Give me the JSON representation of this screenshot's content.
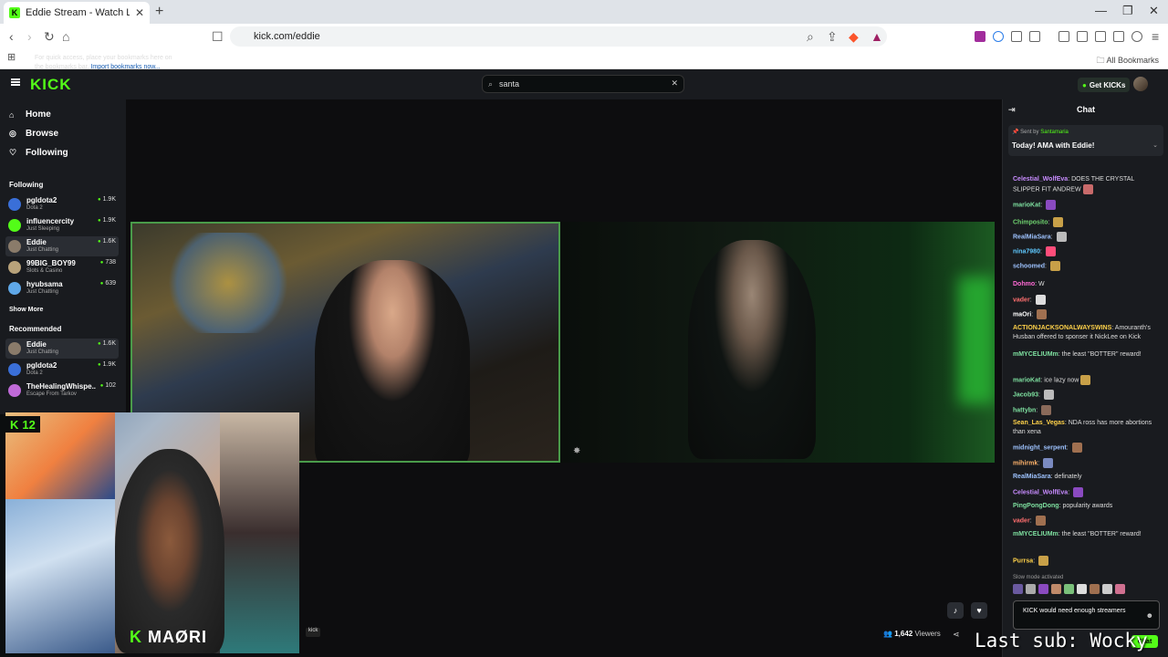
{
  "browser": {
    "tab_title": "Eddie Stream - Watch Live on",
    "url": "kick.com/eddie",
    "bookmarks_message": "For quick access, place your bookmarks here on the bookmarks bar.",
    "bookmarks_link": "Import bookmarks now...",
    "all_bookmarks": "All Bookmarks"
  },
  "header": {
    "logo": "KICK",
    "search_value": "santa",
    "get_kicks": "Get KICKs"
  },
  "sidebar": {
    "nav": [
      {
        "label": "Home"
      },
      {
        "label": "Browse"
      },
      {
        "label": "Following"
      }
    ],
    "following_title": "Following",
    "following": [
      {
        "name": "pgldota2",
        "category": "Dota 2",
        "viewers": "1.9K"
      },
      {
        "name": "influencercity",
        "category": "Just Sleeping",
        "viewers": "1.9K"
      },
      {
        "name": "Eddie",
        "category": "Just Chatting",
        "viewers": "1.6K"
      },
      {
        "name": "99BIG_BOY99",
        "category": "Slots & Casino",
        "viewers": "738"
      },
      {
        "name": "hyubsama",
        "category": "Just Chatting",
        "viewers": "639"
      }
    ],
    "show_more": "Show More",
    "recommended_title": "Recommended",
    "recommended": [
      {
        "name": "Eddie",
        "category": "Just Chatting",
        "viewers": "1.6K"
      },
      {
        "name": "pgldota2",
        "category": "Dota 2",
        "viewers": "1.9K"
      },
      {
        "name": "TheHealingWhispe...",
        "category": "Escape From Tarkov",
        "viewers": "102"
      }
    ]
  },
  "player": {
    "facecam_badge": "12",
    "facecam_brand_k": "K",
    "facecam_brand": "MAØRI",
    "kick_tag": "kick",
    "viewers_count": "1,642",
    "viewers_label": "Viewers",
    "last_sub": "Last sub: Wocky"
  },
  "chat": {
    "title": "Chat",
    "pinned_sent_by": "Sent by",
    "pinned_user": "Santamaria",
    "pinned_text": "Today! AMA with Eddie!",
    "messages": [
      {
        "user": "Celestial_WolfEva",
        "color": "#c88cff",
        "text": "DOES THE CRYSTAL SLIPPER FIT ANDREW"
      },
      {
        "user": "marioKat",
        "color": "#7ee0a0",
        "text": ""
      },
      {
        "user": "Chimposito",
        "color": "#6fd16f",
        "text": ""
      },
      {
        "user": "RealMiaSara",
        "color": "#9ec3ff",
        "text": ""
      },
      {
        "user": "nina7980",
        "color": "#5fc9ff",
        "text": ""
      },
      {
        "user": "schoomed",
        "color": "#9ec3ff",
        "text": ""
      },
      {
        "user": "Dohmo",
        "color": "#ff6ad5",
        "text": "W"
      },
      {
        "user": "vader",
        "color": "#ff6f6f",
        "text": ""
      },
      {
        "user": "maOri",
        "color": "#fff",
        "text": ""
      },
      {
        "user": "ACTIONJACKSONALWAYSWINS",
        "color": "#ffd24a",
        "text": "Amouranth's Husban offered to sponser it NickLee on Kick"
      },
      {
        "user": "mMYCELIUMm",
        "color": "#7ee0a0",
        "text": "the least \"BOTTER\" reward!"
      },
      {
        "user": "marioKat",
        "color": "#7ee0a0",
        "text": "ice lazy now"
      },
      {
        "user": "Jacob93",
        "color": "#7ee0a0",
        "text": ""
      },
      {
        "user": "hattybn",
        "color": "#7ee0a0",
        "text": ""
      },
      {
        "user": "Sean_Las_Vegas",
        "color": "#ffd24a",
        "text": "NDA ross has more abortions than xena"
      },
      {
        "user": "midnight_serpent",
        "color": "#9ec3ff",
        "text": ""
      },
      {
        "user": "mihirmk",
        "color": "#ffb36b",
        "text": ""
      },
      {
        "user": "RealMiaSara",
        "color": "#9ec3ff",
        "text": "definately"
      },
      {
        "user": "Celestial_WolfEva",
        "color": "#c88cff",
        "text": ""
      },
      {
        "user": "PingPongDong",
        "color": "#7ee0a0",
        "text": "popularity awards"
      },
      {
        "user": "vader",
        "color": "#ff6f6f",
        "text": ""
      },
      {
        "user": "mMYCELIUMm",
        "color": "#7ee0a0",
        "text": "the least \"BOTTER\" reward!"
      },
      {
        "user": "Purrsa",
        "color": "#ffd24a",
        "text": ""
      }
    ],
    "slow_mode": "Slow mode activated",
    "input_value": "KICK would need enough streamers",
    "send_label": "Chat"
  },
  "colors": {
    "accent": "#53fc18",
    "background": "#0b0e0f",
    "panel": "#191b1f"
  }
}
